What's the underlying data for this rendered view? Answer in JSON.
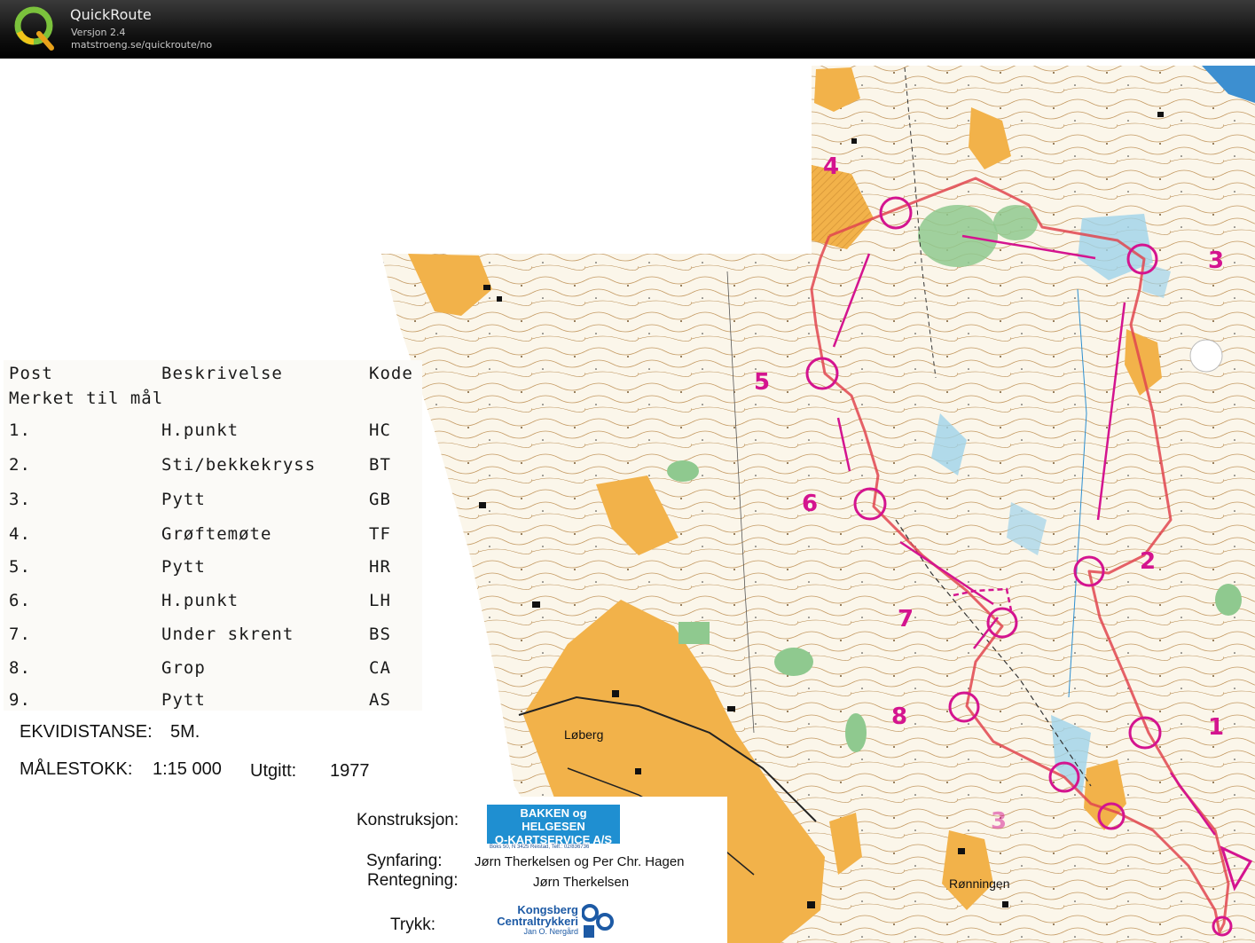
{
  "app": {
    "title": "QuickRoute",
    "version": "Versjon 2.4",
    "url": "matstroeng.se/quickroute/no"
  },
  "description_table": {
    "headers": [
      "Post",
      "Beskrivelse",
      "Kode"
    ],
    "subheader": "Merket til mål",
    "rows": [
      {
        "post": "1.",
        "desc": "H.punkt",
        "code": "HC"
      },
      {
        "post": "2.",
        "desc": "Sti/bekkekryss",
        "code": "BT"
      },
      {
        "post": "3.",
        "desc": "Pytt",
        "code": "GB"
      },
      {
        "post": "4.",
        "desc": "Grøftemøte",
        "code": "TF"
      },
      {
        "post": "5.",
        "desc": "Pytt",
        "code": "HR"
      },
      {
        "post": "6.",
        "desc": "H.punkt",
        "code": "LH"
      },
      {
        "post": "7.",
        "desc": "Under skrent",
        "code": "BS"
      },
      {
        "post": "8.",
        "desc": "Grop",
        "code": "CA"
      },
      {
        "post": "9.",
        "desc": "Pytt",
        "code": "AS"
      }
    ]
  },
  "map_info": {
    "ekvidistanse_label": "EKVIDISTANSE:",
    "ekvidistanse_value": "5M.",
    "malestokk_label": "MÅLESTOKK:",
    "malestokk_value": "1:15 000",
    "utgitt_label": "Utgitt:",
    "utgitt_value": "1977"
  },
  "credits": {
    "konstruksjon_label": "Konstruksjon:",
    "konstruksjon_logo_line1": "BAKKEN og HELGESEN",
    "konstruksjon_logo_line2": "O-KARTSERVICE A/S",
    "konstruksjon_address": "Boks 50, N 3425 Reistad, Telf.: 02/836736",
    "synfaring_label": "Synfaring:",
    "synfaring_value": "Jørn Therkelsen og Per Chr. Hagen",
    "rentegning_label": "Rentegning:",
    "rentegning_value": "Jørn Therkelsen",
    "trykk_label": "Trykk:",
    "trykk_logo_line1": "Kongsberg",
    "trykk_logo_line2": "Centraltrykkeri",
    "trykk_logo_line3": "Jan O. Nergård"
  },
  "map_labels": {
    "place_loberg": "Løberg",
    "place_ronningen": "Rønningen"
  },
  "controls": {
    "numbers": [
      "1",
      "2",
      "3",
      "4",
      "5",
      "6",
      "7",
      "8"
    ]
  },
  "colors": {
    "control_magenta": "#d4148f",
    "route_red": "#e0454f",
    "open_land": "#f2b24a",
    "green": "#8fc98f",
    "water": "#9fd3ea",
    "contour": "#b5874a"
  }
}
